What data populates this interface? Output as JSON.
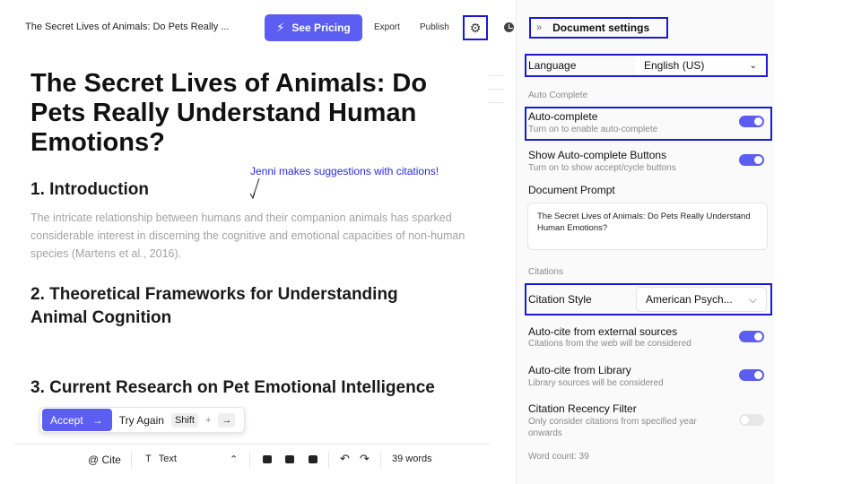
{
  "header": {
    "doc_title": "The Secret Lives of Animals: Do Pets Really ...",
    "pricing_label": "See Pricing",
    "export_label": "Export",
    "publish_label": "Publish"
  },
  "editor": {
    "title": "The Secret Lives of Animals: Do Pets Really Understand Human Emotions?",
    "section1": "1. Introduction",
    "paragraph": "The intricate relationship between humans and their companion animals has sparked considerable interest in discerning the cognitive and emotional capacities of non-human species (Martens et al., 2016).",
    "section2": "2. Theoretical Frameworks for Understanding Animal Cognition",
    "section3": "3. Current Research on Pet Emotional Intelligence",
    "annotation": "Jenni makes suggestions with citations!"
  },
  "suggestion": {
    "accept_label": "Accept",
    "accept_arrow": "→",
    "try_again_label": "Try Again",
    "shortcut_key": "Shift",
    "shortcut_plus": "+",
    "shortcut_arrow": "→"
  },
  "toolbar": {
    "cite_label": "@ Cite",
    "text_icon": "T",
    "text_label": "Text",
    "updown": "⌃",
    "undo": "↶",
    "redo": "↷",
    "word_count": "39 words"
  },
  "settings": {
    "collapse_icon": "»",
    "title": "Document settings",
    "language_label": "Language",
    "language_value": "English (US)",
    "auto_complete_section": "Auto Complete",
    "auto_complete_label": "Auto-complete",
    "auto_complete_sub": "Turn on to enable auto-complete",
    "show_buttons_label": "Show Auto-complete Buttons",
    "show_buttons_sub": "Turn on to show accept/cycle buttons",
    "prompt_label": "Document Prompt",
    "prompt_value": "The Secret Lives of Animals: Do Pets Really Understand Human Emotions?",
    "citations_section": "Citations",
    "citation_style_label": "Citation Style",
    "citation_style_value": "American Psych...",
    "auto_cite_external_label": "Auto-cite from external sources",
    "auto_cite_external_sub": "Citations from the web will be considered",
    "auto_cite_library_label": "Auto-cite from Library",
    "auto_cite_library_sub": "Library sources will be considered",
    "recency_label": "Citation Recency Filter",
    "recency_sub": "Only consider citations from specified year onwards",
    "word_count": "Word count: 39"
  },
  "toggles": {
    "auto_complete": true,
    "show_buttons": true,
    "auto_cite_external": true,
    "auto_cite_library": true,
    "recency_filter": false
  },
  "colors": {
    "accent": "#5b5ef0",
    "highlight_box": "#1a1ad6",
    "annotation": "#2a2ad8"
  }
}
